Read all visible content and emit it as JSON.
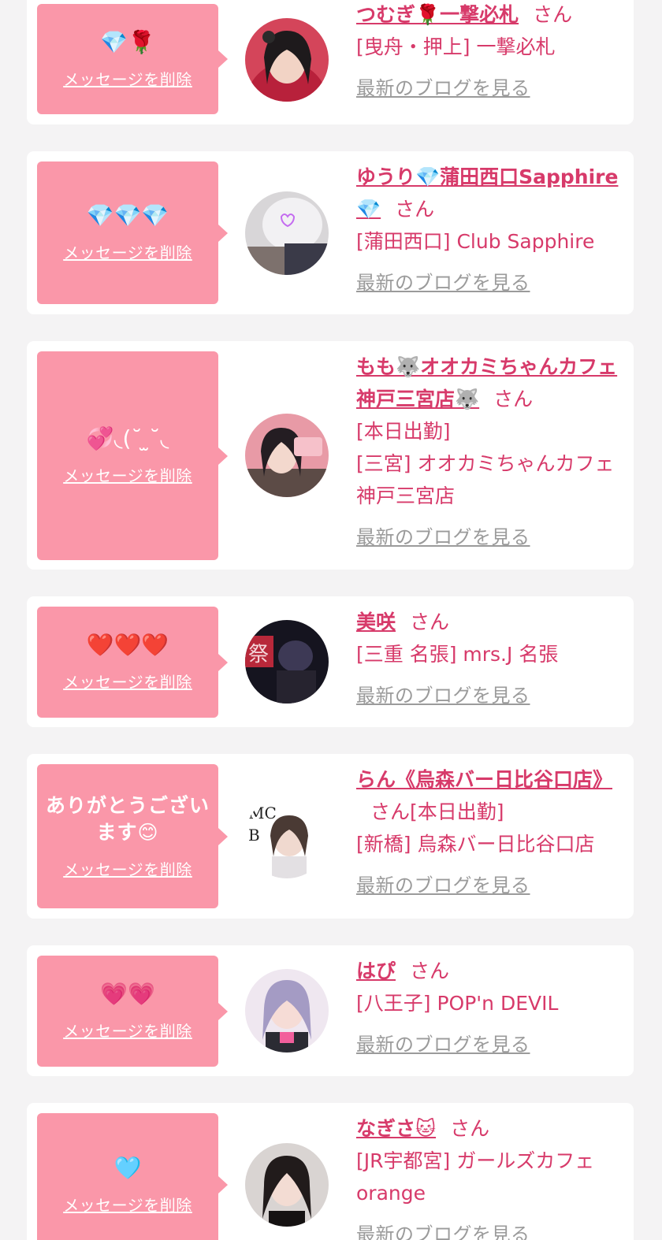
{
  "common": {
    "delete_label": "メッセージを削除",
    "blog_label": "最新のブログを見る",
    "san": "さん"
  },
  "colors": {
    "page_bg": "#f4f3f4",
    "card_bg": "#ffffff",
    "bubble_bg": "#fa97a9",
    "accent_text": "#d73a6a",
    "muted_link": "#9b9b9b"
  },
  "messages": [
    {
      "message": "💎🌹",
      "name": "つむぎ🌹一撃必札",
      "status": "",
      "shop": "[曳舟・押上] 一撃必札"
    },
    {
      "message": "💎💎💎",
      "name": "ゆうり💎蒲田西口Sapphire💎",
      "status": "",
      "shop": "[蒲田西口] Club Sapphire"
    },
    {
      "message": "💞◟(˘ ̫˘◟",
      "name": "もも🐺オオカミちゃんカフェ神戸三宮店🐺",
      "status": "[本日出勤]",
      "shop": "[三宮] オオカミちゃんカフェ神戸三宮店"
    },
    {
      "message": "❤️❤️❤️",
      "name": "美咲",
      "status": "",
      "shop": "[三重 名張] mrs.J 名張"
    },
    {
      "message": "ありがとうございます😊",
      "name": "らん《烏森バー日比谷口店》",
      "status": "[本日出勤]",
      "shop": "[新橋] 烏森バー日比谷口店"
    },
    {
      "message": "💗💗",
      "name": "はぴ",
      "status": "",
      "shop": "[八王子] POP'n DEVIL"
    },
    {
      "message": "🩵",
      "name": "なぎさ🐱",
      "status": "",
      "shop": "[JR宇都宮] ガールズカフェorange"
    }
  ]
}
